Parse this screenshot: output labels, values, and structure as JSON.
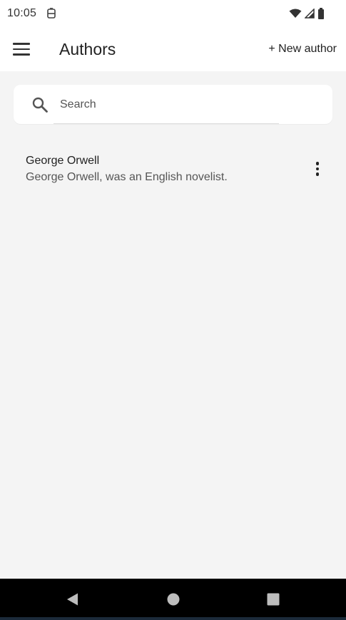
{
  "status_bar": {
    "time": "10:05",
    "icons": [
      "notification-icon",
      "wifi-icon",
      "cell-signal-icon",
      "battery-icon"
    ]
  },
  "app_bar": {
    "menu_icon": "hamburger-menu-icon",
    "title": "Authors",
    "new_author_label": "+ New author"
  },
  "search": {
    "icon": "search-icon",
    "placeholder": "Search",
    "value": ""
  },
  "authors": [
    {
      "name": "George Orwell",
      "description": "George Orwell, was an English novelist.",
      "menu_icon": "more-vert-icon"
    }
  ],
  "nav_bar": {
    "icons": [
      "back-triangle-icon",
      "home-circle-icon",
      "recents-square-icon"
    ]
  },
  "colors": {
    "background": "#f4f4f4",
    "surface": "#ffffff",
    "nav_bar": "#000000",
    "text_primary": "#222222",
    "text_secondary": "#555555"
  }
}
